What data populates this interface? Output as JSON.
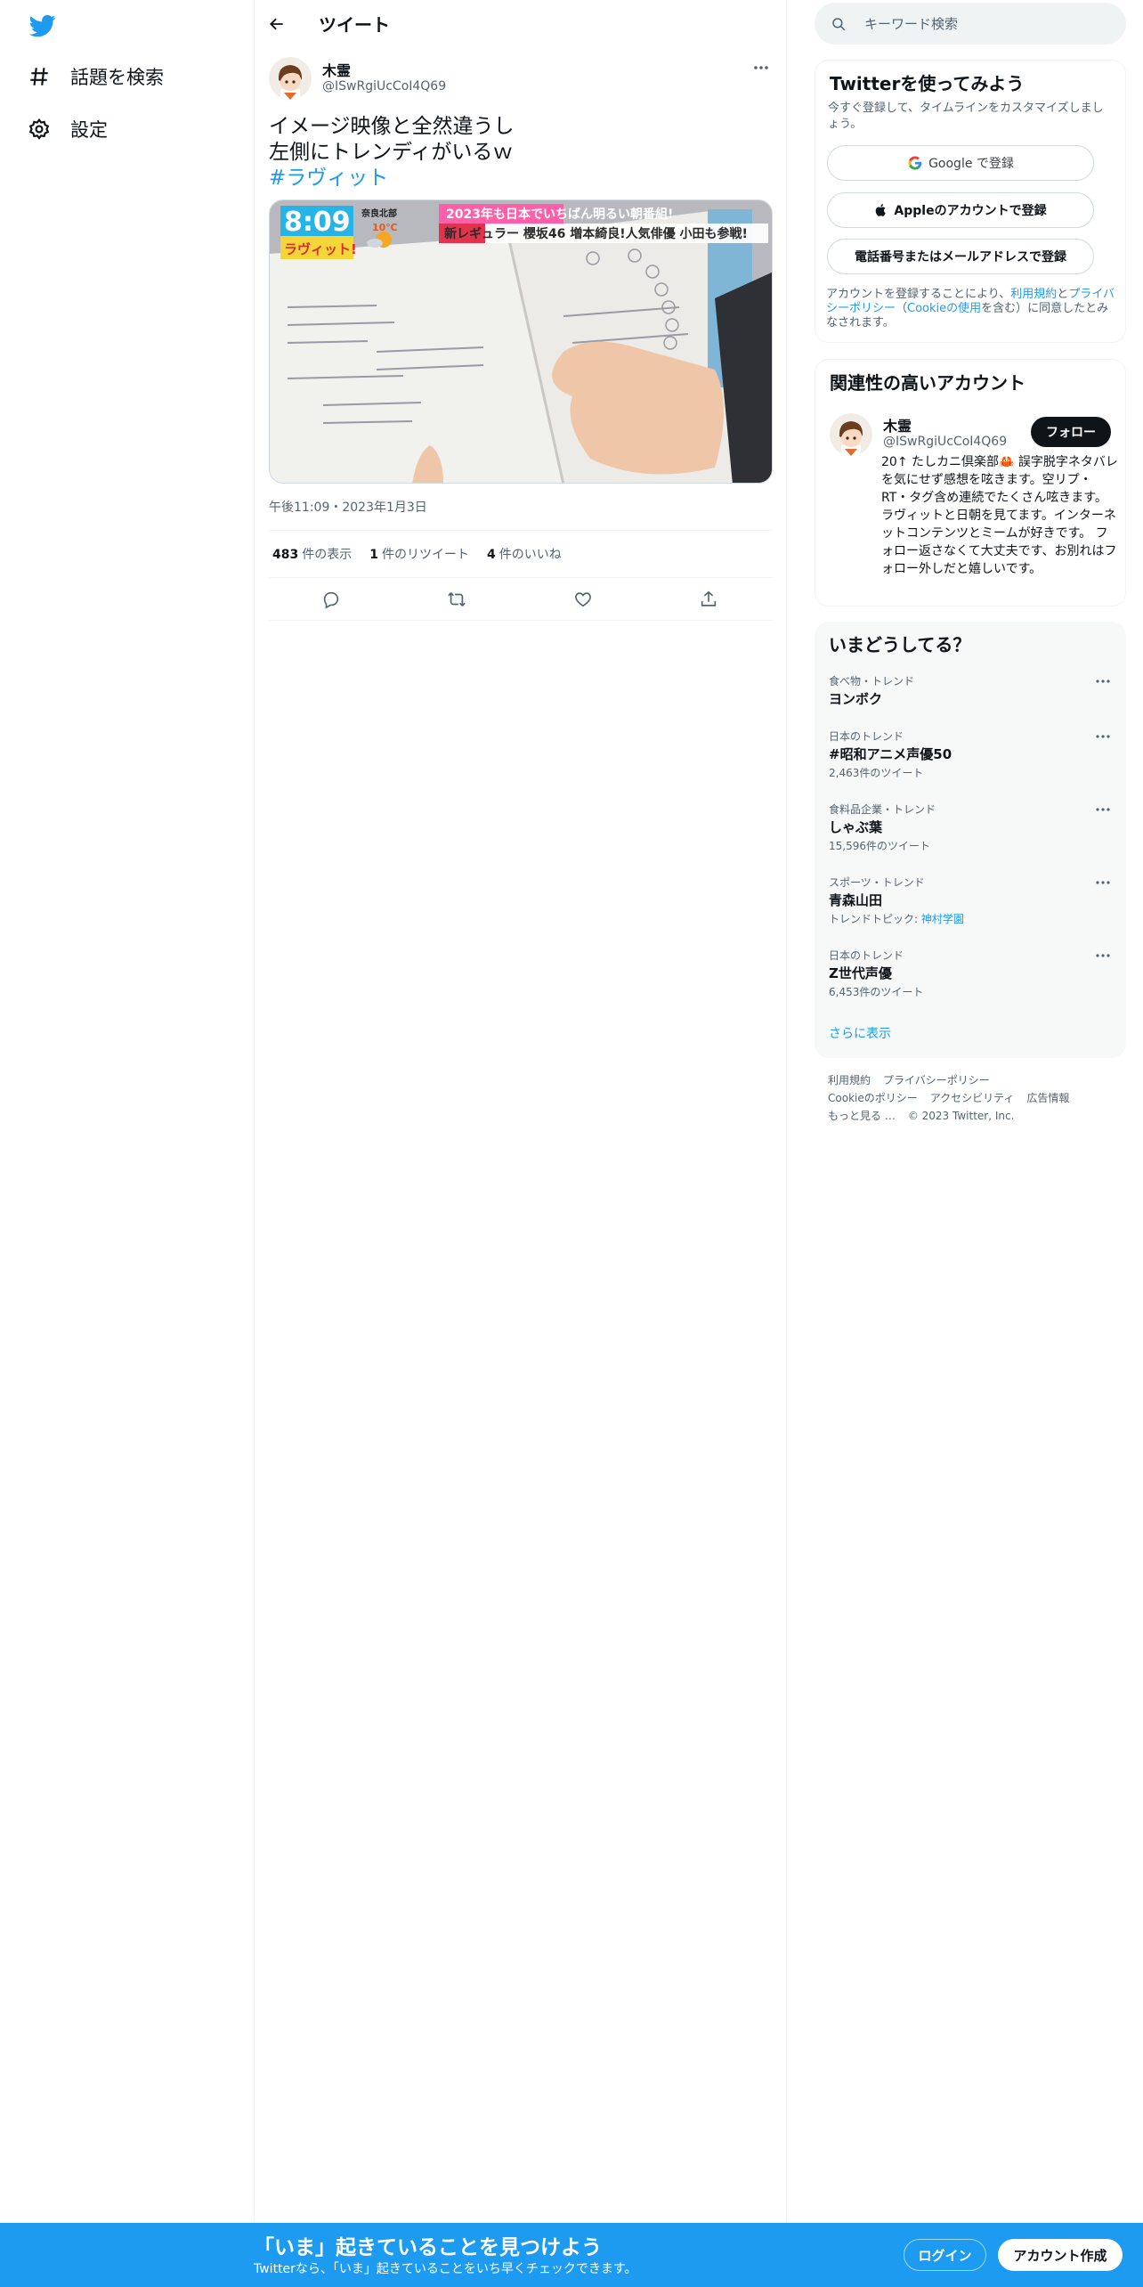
{
  "colors": {
    "accent": "#1d9bf0",
    "text": "#0f1419",
    "muted": "#536471",
    "banner": "#1d9bf0"
  },
  "nav": {
    "logo_icon": "twitter-bird-icon",
    "items": [
      {
        "label": "話題を検索",
        "icon": "hashtag-icon"
      },
      {
        "label": "設定",
        "icon": "gear-icon"
      }
    ]
  },
  "header": {
    "title": "ツイート",
    "back_icon": "back-arrow-icon"
  },
  "tweet": {
    "author_name": "木霊",
    "author_handle": "@ISwRgiUcCoI4Q69",
    "text_lines": [
      "イメージ映像と全然違うし",
      "左側にトレンディがいるｗ"
    ],
    "hashtag": "#ラヴィット",
    "image_caption_lines": [
      "2023年も日本でいちばん明るい朝番組!",
      "新レギュラー 櫻坂46 増本綺良!人気俳優 小田も参戦!"
    ],
    "image_clock": "8:09",
    "image_logo": "ラヴィット!",
    "image_weather": "奈良北部",
    "image_temp": "10℃",
    "timestamp": "午後11:09・2023年1月3日",
    "stats": [
      {
        "num": "483",
        "label": "件の表示"
      },
      {
        "num": "1",
        "label": "件のリツイート"
      },
      {
        "num": "4",
        "label": "件のいいね"
      }
    ],
    "actions": [
      "reply-icon",
      "retweet-icon",
      "like-icon",
      "share-icon"
    ]
  },
  "search": {
    "placeholder": "キーワード検索",
    "icon": "search-icon"
  },
  "signup": {
    "title": "Twitterを使ってみよう",
    "subtitle": "今すぐ登録して、タイムラインをカスタマイズしましょう。",
    "google_label": "Google で登録",
    "apple_label": "Appleのアカウントで登録",
    "phone_label": "電話番号またはメールアドレスで登録",
    "legal_prefix": "アカウントを登録することにより、",
    "legal_terms": "利用規約",
    "legal_and": "と",
    "legal_privacy": "プライバシーポリシー",
    "legal_open": "（",
    "legal_cookie": "Cookieの使用",
    "legal_suffix": "を含む）に同意したとみなされます。"
  },
  "related": {
    "title": "関連性の高いアカウント",
    "name": "木霊",
    "handle": "@ISwRgiUcCoI4Q69",
    "follow_label": "フォロー",
    "bio": "20↑ たしカニ倶楽部🦀 誤字脱字ネタバレを気にせず感想を呟きます。空リプ・RT・タグ含め連続でたくさん呟きます。 ラヴィットと日朝を見てます。インターネットコンテンツとミームが好きです。 フォロー返さなくて大丈夫です、お別れはフォロー外しだと嬉しいです。"
  },
  "trends": {
    "title": "いまどうしてる？",
    "items": [
      {
        "meta": "食べ物・トレンド",
        "name": "ヨンボク",
        "count": ""
      },
      {
        "meta": "日本のトレンド",
        "name": "#昭和アニメ声優50",
        "count": "2,463件のツイート"
      },
      {
        "meta": "食料品企業・トレンド",
        "name": "しゃぶ葉",
        "count": "15,596件のツイート"
      },
      {
        "meta": "スポーツ・トレンド",
        "name": "青森山田",
        "count": "トレンドトピック:",
        "topic": "神村学園"
      },
      {
        "meta": "日本のトレンド",
        "name": "Z世代声優",
        "count": "6,453件のツイート"
      }
    ],
    "show_more": "さらに表示"
  },
  "footer": {
    "links": [
      "利用規約",
      "プライバシーポリシー",
      "Cookieのポリシー",
      "アクセシビリティ",
      "広告情報",
      "もっと見る …"
    ],
    "copyright": "© 2023 Twitter, Inc."
  },
  "banner": {
    "title": "「いま」起きていることを見つけよう",
    "subtitle": "Twitterなら、「いま」起きていることをいち早くチェックできます。",
    "login_label": "ログイン",
    "signup_label": "アカウント作成"
  }
}
